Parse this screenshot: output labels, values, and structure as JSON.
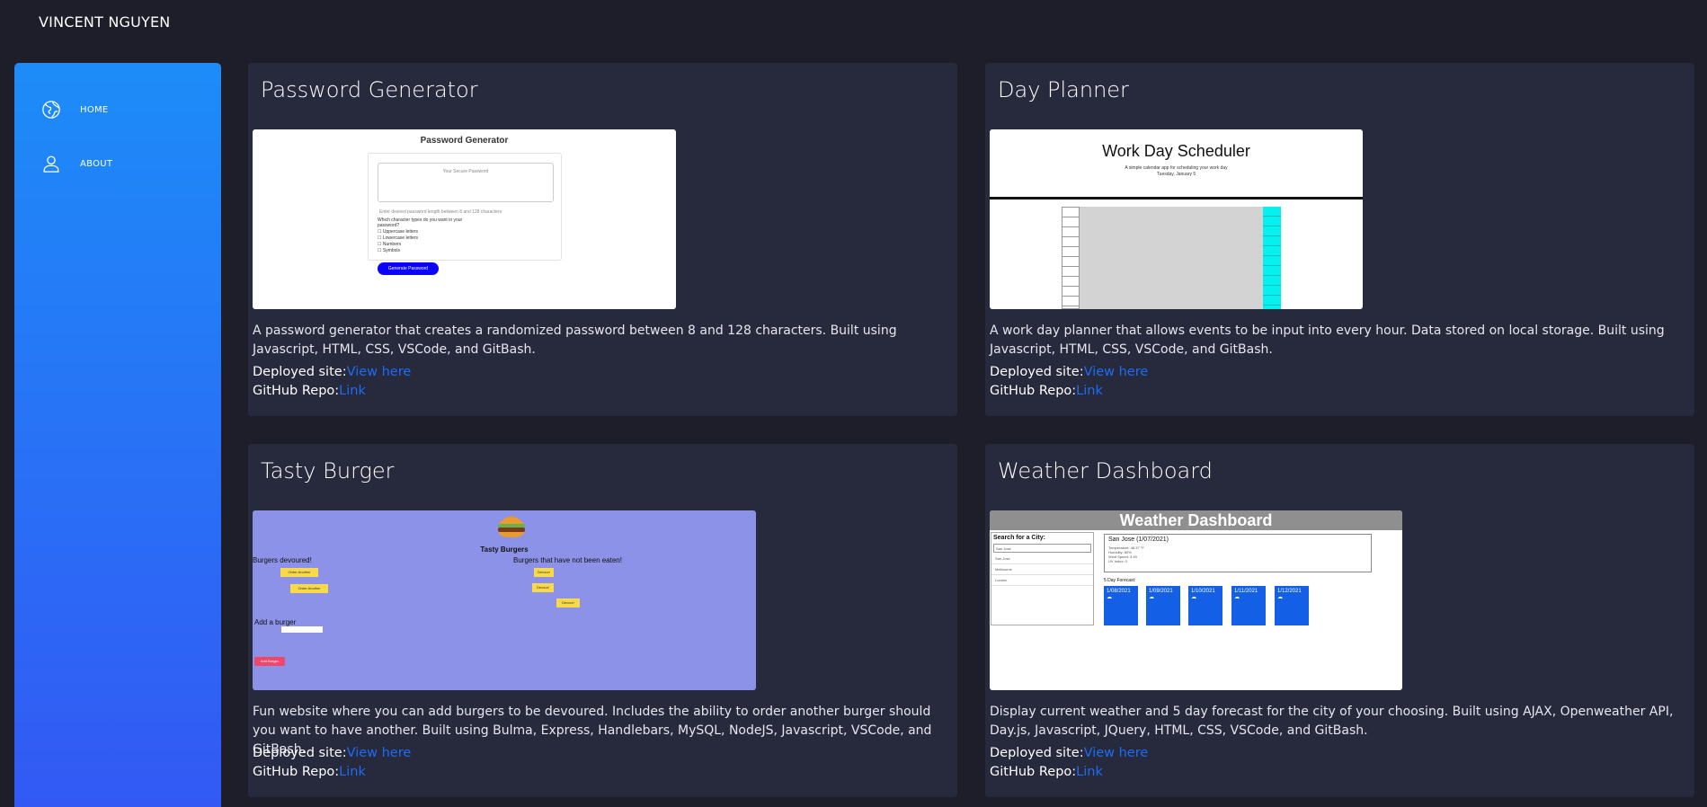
{
  "brand": "VINCENT NGUYEN",
  "sidebar": {
    "items": [
      {
        "label": "HOME",
        "icon": "globe-icon"
      },
      {
        "label": "ABOUT",
        "icon": "user-icon"
      }
    ]
  },
  "common": {
    "deployed_label": "Deployed site:",
    "deployed_link": "View here",
    "repo_label": "GitHub Repo:",
    "repo_link": "Link"
  },
  "projects": [
    {
      "title": "Password Generator",
      "description": "A password generator that creates a randomized password between 8 and 128 characters. Built using Javascript, HTML, CSS, VSCode, and GitBash.",
      "preview": {
        "heading": "Password Generator",
        "placeholder": "Your Secure Password",
        "prompt": "Enter desired password length between 8 and 128 characters",
        "question": "Which character types do you want in your password?",
        "options": [
          "Uppercase letters",
          "Lowercase letters",
          "Numbers",
          "Symbols"
        ],
        "button": "Generate Password"
      }
    },
    {
      "title": "Day Planner",
      "description": "A work day planner that allows events to be input into every hour. Data stored on local storage. Built using Javascript, HTML, CSS, VSCode, and GitBash.",
      "preview": {
        "heading": "Work Day Scheduler",
        "subheading": "A simple calendar app for scheduling your work day",
        "date": "Tuesday, January 5"
      }
    },
    {
      "title": "Tasty Burger",
      "description": "Fun website where you can add burgers to be devoured. Includes the ability to order another burger should you want to have another. Built using Bulma, Express, Handlebars, MySQL, NodeJS, Javascript, VSCode, and GitBash.",
      "preview": {
        "heading": "Tasty Burgers",
        "devoured": "Burgers devoured!",
        "not_eaten": "Burgers that have not been eaten!",
        "add": "Add a burger",
        "order_again": "Order Another",
        "devour": "Devour!",
        "add_button": "Add Burger"
      }
    },
    {
      "title": "Weather Dashboard",
      "description": "Display current weather and 5 day forecast for the city of your choosing. Built using AJAX, Openweather API, Day.js, Javascript, JQuery, HTML, CSS, VSCode, and GitBash.",
      "preview": {
        "heading": "Weather Dashboard",
        "search": "Search for a City:",
        "search_value": "San Jose",
        "cities": [
          "San Jose",
          "Melbourne",
          "London"
        ],
        "current": "San Jose (1/07/2021)",
        "current_lines": [
          "Temperature: 48.37 °F",
          "Humidity: 80%",
          "Wind Speed: 3.49",
          "UV Index: 0"
        ],
        "forecast_label": "5 Day Forecast:",
        "days": [
          "1/08/2021",
          "1/09/2021",
          "1/10/2021",
          "1/11/2021",
          "1/12/2021"
        ]
      }
    }
  ]
}
